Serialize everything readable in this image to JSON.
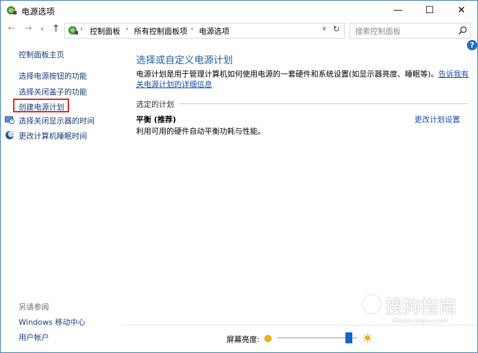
{
  "window": {
    "title": "电源选项",
    "minimize_glyph": "—",
    "maximize_glyph": "☐",
    "close_glyph": "✕"
  },
  "nav": {
    "back_glyph": "←",
    "forward_glyph": "→",
    "dropdown_glyph": "∨",
    "up_glyph": "↑"
  },
  "address": {
    "crumbs": [
      "控制面板",
      "所有控制面板项",
      "电源选项"
    ],
    "separator": "›",
    "dropdown_glyph": "∨",
    "refresh_glyph": "↻"
  },
  "search": {
    "placeholder": "搜索控制面板"
  },
  "help": {
    "glyph": "?"
  },
  "left_pane": {
    "home": "控制面板主页",
    "links": [
      "选择电源按钮的功能",
      "选择关闭盖子的功能",
      "创建电源计划",
      "选择关闭显示器的时间",
      "更改计算机睡眠时间"
    ],
    "see_also_title": "另请参阅",
    "see_also": [
      "Windows 移动中心",
      "用户帐户"
    ]
  },
  "main": {
    "title": "选择或自定义电源计划",
    "description": "电源计划是用于管理计算机如何使用电源的一套硬件和系统设置(如显示器亮度、睡眠等)。",
    "description_link": "告诉我有关电源计划的详细信息",
    "section_title": "选定的计划",
    "plan": {
      "name": "平衡 (推荐)",
      "description": "利用可用的硬件自动平衡功耗与性能。",
      "change_link": "更改计划设置"
    }
  },
  "bottom": {
    "brightness_label": "屏幕亮度:",
    "brightness_level": 0.9
  },
  "watermark": {
    "text": "搜狗指南",
    "sub": "zhinan.sogou.com"
  },
  "colors": {
    "link": "#1a4fa8",
    "title_blue": "#1e5fa8",
    "highlight_red": "#e0262b",
    "slider_thumb": "#1466c8"
  }
}
